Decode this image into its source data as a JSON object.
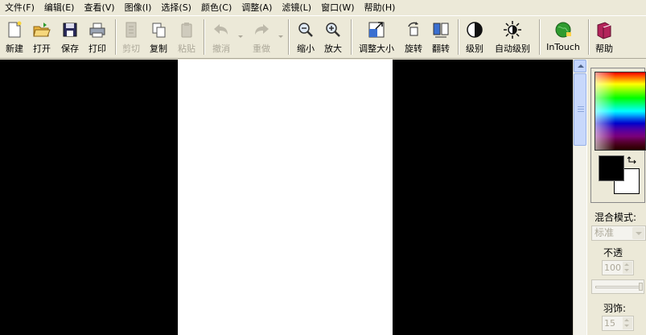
{
  "menu": [
    "文件(F)",
    "编辑(E)",
    "查看(V)",
    "图像(I)",
    "选择(S)",
    "颜色(C)",
    "调整(A)",
    "滤镜(L)",
    "窗口(W)",
    "帮助(H)"
  ],
  "toolbar": {
    "new": "新建",
    "open": "打开",
    "save": "保存",
    "print": "打印",
    "cut": "剪切",
    "copy": "复制",
    "paste": "粘贴",
    "undo": "撤消",
    "redo": "重做",
    "zoom_out": "缩小",
    "zoom_in": "放大",
    "resize": "调整大小",
    "rotate": "旋转",
    "flip": "翻转",
    "levels": "级别",
    "auto_levels": "自动级别",
    "intouch": "InTouch",
    "help": "帮助"
  },
  "panel": {
    "blend_mode_label": "混合模式:",
    "blend_mode_value": "标准",
    "opacity_label": "不透",
    "opacity_value": "100",
    "feather_label": "羽饰:",
    "feather_value": "15"
  },
  "colors": {
    "foreground": "#000000",
    "background": "#ffffff",
    "canvas_background": "#000000",
    "document": "#ffffff"
  }
}
